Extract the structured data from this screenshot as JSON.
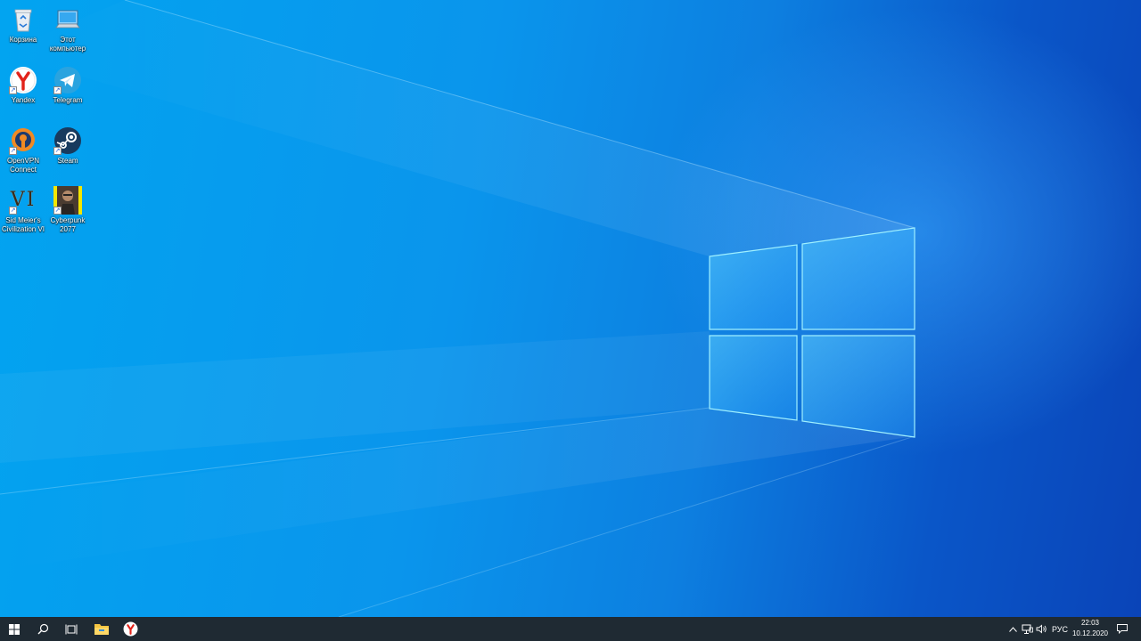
{
  "desktop": {
    "icons": [
      {
        "label": "Корзина",
        "icon": "recycle-bin-icon"
      },
      {
        "label": "Этот\nкомпьютер",
        "icon": "this-pc-icon"
      },
      {
        "label": "Yandex",
        "icon": "yandex-browser-icon"
      },
      {
        "label": "Telegram",
        "icon": "telegram-icon"
      },
      {
        "label": "OpenVPN\nConnect",
        "icon": "openvpn-icon"
      },
      {
        "label": "Steam",
        "icon": "steam-icon"
      },
      {
        "label": "Sid Meier's\nCivilization VI",
        "icon": "civilization-vi-icon",
        "glyph": "VI"
      },
      {
        "label": "Cyberpunk\n2077",
        "icon": "cyberpunk-2077-icon"
      }
    ]
  },
  "taskbar": {
    "start": "windows-start-icon",
    "search": "search-icon",
    "task_view": "task-view-icon",
    "pinned": [
      "file-explorer-icon",
      "yandex-browser-icon"
    ],
    "tray": {
      "language": "РУС",
      "time": "22:03",
      "date": "10.12.2020"
    }
  },
  "colors": {
    "desktop_light": "#02a4f0",
    "desktop_dark": "#0a44b8",
    "taskbar": "#1f2a33"
  }
}
